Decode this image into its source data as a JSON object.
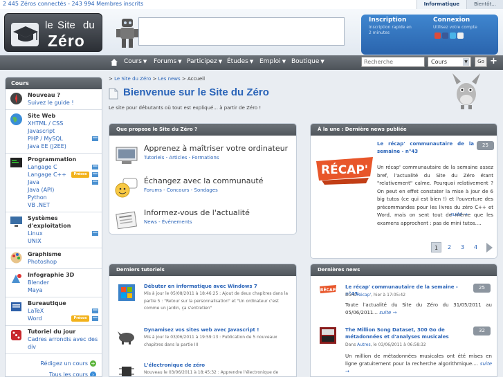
{
  "top": {
    "stats": "2 445 Zéros connectés - 243 994 Membres inscrits",
    "tabs": [
      "Informatique",
      "Bientôt..."
    ]
  },
  "logo": {
    "le": "le",
    "site": "Site",
    "du": "du",
    "zero": "Zéro"
  },
  "account": {
    "inscription": "Inscription",
    "inscription_sub": "Inscription rapide en 2 minutes",
    "connexion": "Connexion",
    "connexion_sub": "Utilisez votre compte"
  },
  "nav": {
    "items": [
      "Cours",
      "Forums",
      "Participez",
      "Études",
      "Emploi",
      "Boutique"
    ],
    "search_placeholder": "Recherche",
    "search_scope": "Cours",
    "go": "Go"
  },
  "sidebar": {
    "title": "Cours",
    "categories": [
      {
        "title": "Nouveau ?",
        "links": [
          "Suivez le guide !"
        ]
      },
      {
        "title": "Site Web",
        "links": [
          "XHTML / CSS",
          "Javascript",
          "PHP / MySQL",
          "Java EE (J2EE)"
        ]
      },
      {
        "title": "Programmation",
        "links": [
          "Langage C",
          "Langage C++",
          "Java",
          "Java (API)",
          "Python",
          "VB .NET"
        ]
      },
      {
        "title": "Systèmes d'exploitation",
        "links": [
          "Linux",
          "UNIX"
        ]
      },
      {
        "title": "Graphisme",
        "links": [
          "Photoshop"
        ]
      },
      {
        "title": "Infographie 3D",
        "links": [
          "Blender",
          "Maya"
        ]
      },
      {
        "title": "Bureautique",
        "links": [
          "LaTeX",
          "Word"
        ]
      },
      {
        "title": "Tutoriel du jour",
        "links": [
          "Cadres arrondis avec des div"
        ]
      }
    ],
    "precos": "Précos",
    "write_course": "Rédigez un cours",
    "all_courses": "Tous les cours"
  },
  "breadcrumb": [
    "Le Site du Zéro",
    "Les news",
    "Accueil"
  ],
  "page_title": "Bienvenue sur le Site du Zéro",
  "intro": "Le site pour débutants où tout est expliqué... à partir de Zéro !",
  "propose": {
    "title": "Que propose le Site du Zéro ?",
    "items": [
      {
        "title": "Apprenez à maîtriser votre ordinateur",
        "links": [
          "Tutoriels",
          "Articles",
          "Formations"
        ]
      },
      {
        "title": "Échangez avec la communauté",
        "links": [
          "Forums",
          "Concours",
          "Sondages"
        ]
      },
      {
        "title": "Informez-vous de l'actualité",
        "links": [
          "News",
          "Événements"
        ]
      }
    ]
  },
  "une": {
    "title": "À la une : Dernière news publiée",
    "news_title": "Le récap' communautaire de la semaine - n°43",
    "comments": "25",
    "text": "Un récap' communautaire de la semaine assez bref, l'actualité du Site du Zéro étant \"relativement\" calme. Pourquoi relativement ? On peut en effet constater la mise à jour de 6 big tutos (ce qui est bien !) et l'ouverture des précommandes pour les livres du zéro C++ et Word, mais on sent tout de même que les examens approchent : pas de mini tutos....",
    "more": "suite →",
    "pages": [
      "1",
      "2",
      "3",
      "4"
    ]
  },
  "tutos": {
    "title": "Derniers tutoriels",
    "items": [
      {
        "title": "Débuter en informatique avec Windows 7",
        "meta": "Mis à jour le 05/08/2011 à 18:46:25 : Ajout de deux chapitres dans la partie 5 : \"Retour sur la personnalisation\" et \"Un ordinateur c'est comme un jardin, ça s'entretien\""
      },
      {
        "title": "Dynamisez vos sites web avec Javascript !",
        "meta": "Mis à jour le 03/06/2011 à 19:59:13 : Publication de 5 nouveaux chapitres dans la partie III"
      },
      {
        "title": "L'électronique de zéro",
        "meta": "Nouveau le 03/06/2011 à 18:45:32 : Apprendre l'électronique de"
      }
    ]
  },
  "news": {
    "title": "Dernières news",
    "items": [
      {
        "title": "Le récap' communautaire de la semaine - n°43",
        "comments": "25",
        "meta_prefix": "Dans",
        "meta_cat": "Récap'",
        "meta_date": ", hier à 17:05:42",
        "text": "Toute l'actualité du Site du Zéro du 31/05/2011 au 05/06/2011...",
        "more": "suite →"
      },
      {
        "title": "The Million Song Dataset, 300 Go de métadonnées et d'analyses musicales",
        "comments": "32",
        "meta_prefix": "Dans",
        "meta_cat": "Autres",
        "meta_date": ", le 03/06/2011 à 06:58:32",
        "text": "Un million de métadonnées musicales ont été mises en ligne gratuitement pour la recherche algorithmique....",
        "more": "suite →"
      }
    ]
  },
  "colors": {
    "accent": "#2a64b8",
    "header_dark": "#50565c",
    "account_blue": "#2a64ad",
    "precos": "#f2b21b"
  }
}
